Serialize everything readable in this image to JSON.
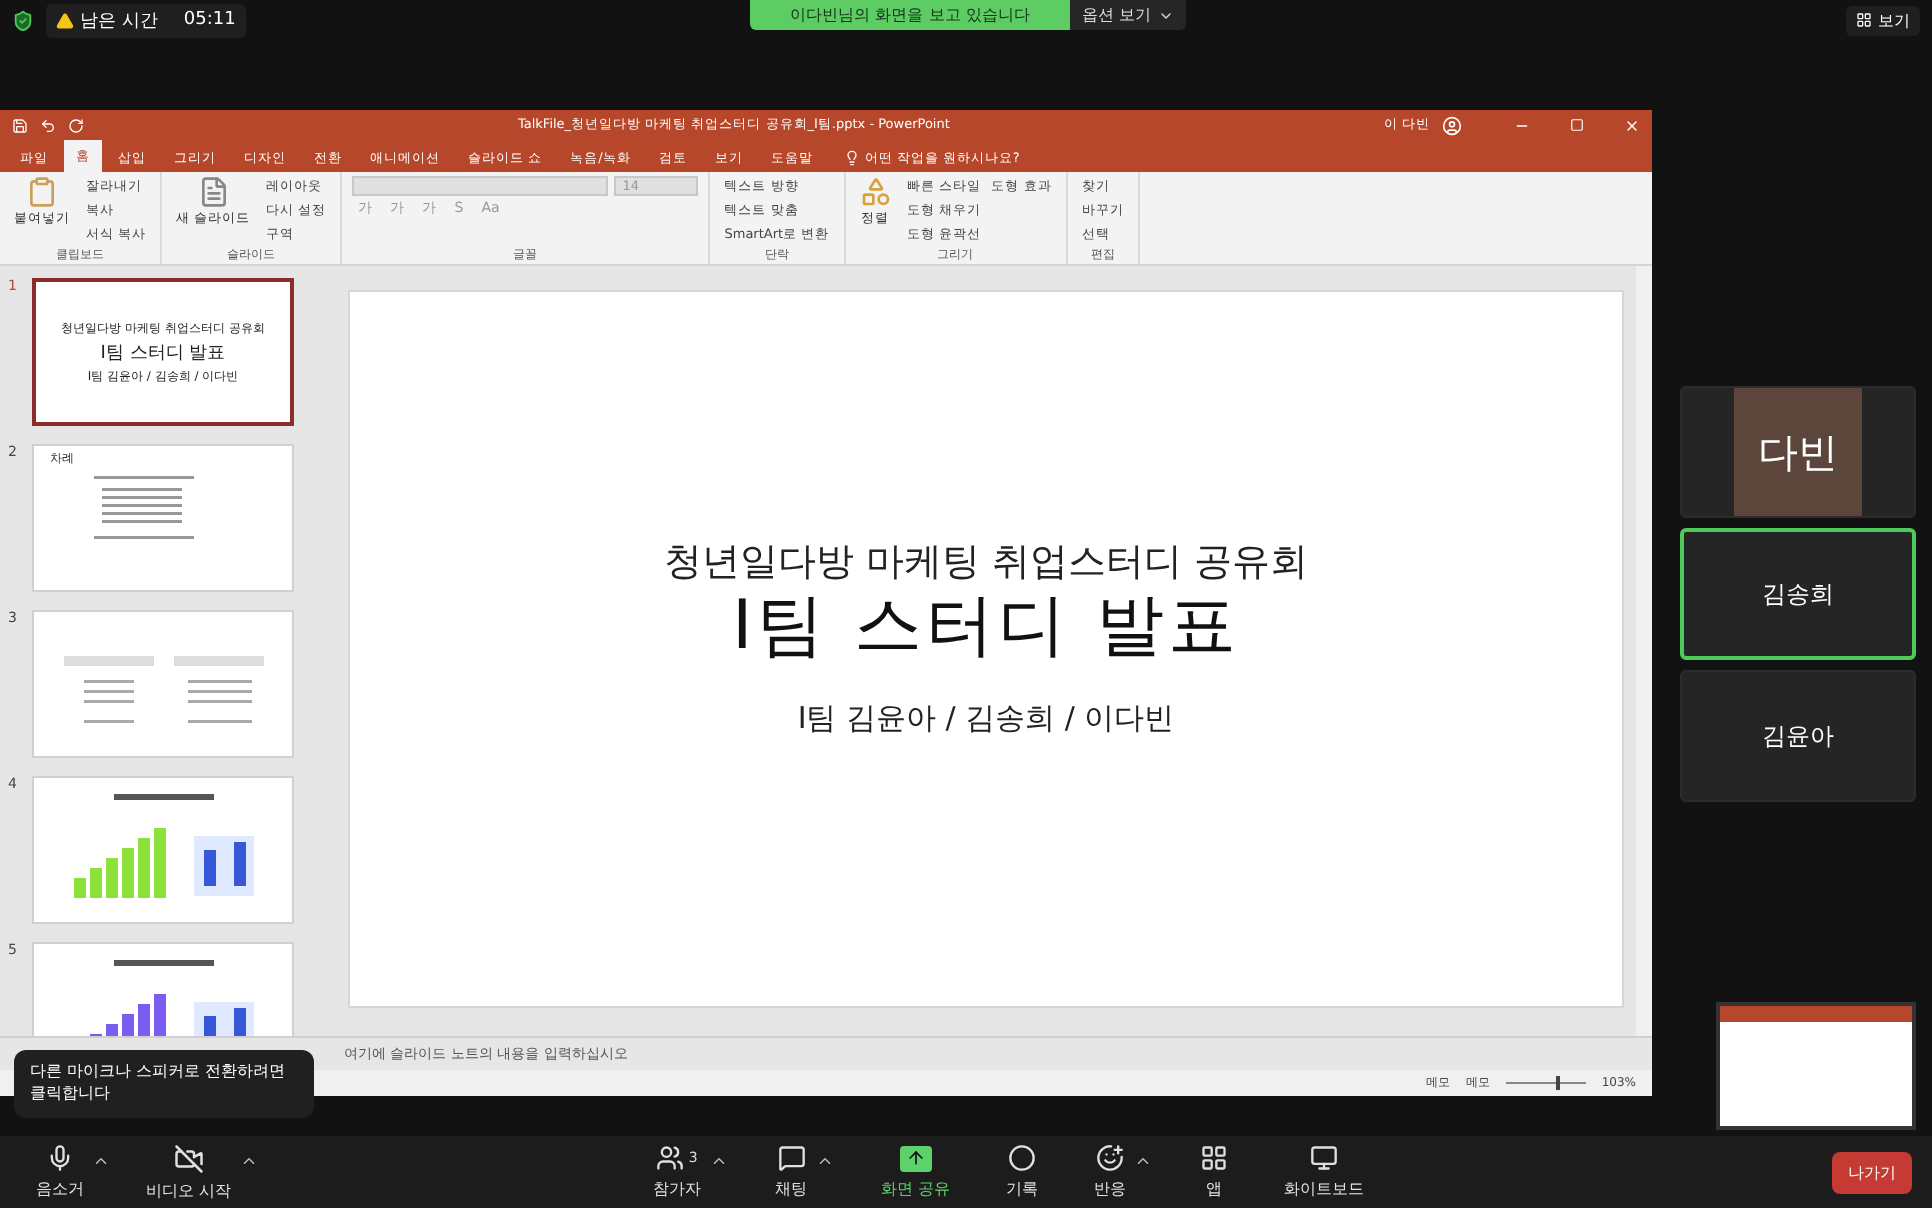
{
  "top_bar": {
    "time_label": "남은 시간",
    "time": "05:11",
    "sharing_banner": "이다빈님의 화면을 보고 있습니다",
    "options_button": "옵션 보기",
    "view_button": "보기"
  },
  "ppt": {
    "title": "TalkFile_청년일다방 마케팅 취업스터디 공유회_I팀.pptx  -  PowerPoint",
    "user": "이 다빈",
    "tabs": [
      {
        "label": "파일",
        "selected": false
      },
      {
        "label": "홈",
        "selected": true
      },
      {
        "label": "삽입",
        "selected": false
      },
      {
        "label": "그리기",
        "selected": false
      },
      {
        "label": "디자인",
        "selected": false
      },
      {
        "label": "전환",
        "selected": false
      },
      {
        "label": "애니메이션",
        "selected": false
      },
      {
        "label": "슬라이드 쇼",
        "selected": false
      },
      {
        "label": "녹음/녹화",
        "selected": false
      },
      {
        "label": "검토",
        "selected": false
      },
      {
        "label": "보기",
        "selected": false
      },
      {
        "label": "도움말",
        "selected": false
      }
    ],
    "tell_me": "어떤 작업을 원하시나요?",
    "ribbon_groups": [
      {
        "kind": "list",
        "label": "클립보드",
        "big": "붙여넣기",
        "items": [
          "잘라내기",
          "복사",
          "서식 복사"
        ]
      },
      {
        "kind": "list",
        "label": "슬라이드",
        "big": "새 슬라이드",
        "items": [
          "레이아웃",
          "다시 설정",
          "구역"
        ]
      },
      {
        "kind": "font",
        "label": "글꼴",
        "size": "14",
        "items": [
          "가",
          "가",
          "가",
          "S",
          "Aa"
        ]
      },
      {
        "kind": "list",
        "label": "단락",
        "items": [
          "텍스트 방향",
          "텍스트 맞춤",
          "SmartArt로 변환"
        ]
      },
      {
        "kind": "list",
        "label": "그리기",
        "big": "정렬",
        "items": [
          "빠른 스타일",
          "도형 채우기",
          "도형 윤곽선",
          "도형 효과"
        ]
      },
      {
        "kind": "list",
        "label": "편집",
        "items": [
          "찾기",
          "바꾸기",
          "선택"
        ]
      }
    ],
    "slides": [
      {
        "number": "1",
        "selected": true,
        "kind": "title",
        "lines": [
          "청년일다방 마케팅 취업스터디 공유회",
          "I팀 스터디 발표",
          "I팀 김윤아 / 김송희 / 이다빈"
        ]
      },
      {
        "number": "2",
        "selected": false,
        "kind": "toc",
        "lines": [
          "차례"
        ]
      },
      {
        "number": "3",
        "selected": false,
        "kind": "content"
      },
      {
        "number": "4",
        "selected": false,
        "kind": "chart"
      },
      {
        "number": "5",
        "selected": false,
        "kind": "chart"
      }
    ],
    "slide": {
      "subtitle": "청년일다방 마케팅 취업스터디 공유회",
      "title": "I팀 스터디 발표",
      "members": "I팀 김윤아 / 김송희 / 이다빈"
    },
    "notes_placeholder": "여기에 슬라이드 노트의 내용을 입력하십시오",
    "status": {
      "notes": "메모",
      "comments": "메모",
      "zoom": "103%",
      "level": 0.65
    }
  },
  "participants": [
    {
      "name": "다빈",
      "kind": "avatar",
      "selected": false
    },
    {
      "name": "김송희",
      "kind": "name",
      "selected": true
    },
    {
      "name": "김윤아",
      "kind": "name",
      "selected": false
    }
  ],
  "tooltip": "다른 마이크나 스피커로 전환하려면 클릭합니다",
  "toolbar_left": [
    {
      "kind": "mic",
      "label": "음소거"
    },
    {
      "kind": "video",
      "label": "비디오 시작"
    }
  ],
  "toolbar_center": [
    {
      "kind": "participants",
      "label": "참가자",
      "count": "3",
      "caret": true
    },
    {
      "kind": "chat",
      "label": "채팅",
      "caret": true
    },
    {
      "kind": "share",
      "label": "화면 공유",
      "caret": false
    },
    {
      "kind": "record",
      "label": "기록",
      "caret": false
    },
    {
      "kind": "reaction",
      "label": "반응",
      "caret": true
    },
    {
      "kind": "apps",
      "label": "앱",
      "caret": false
    },
    {
      "kind": "whiteboard",
      "label": "화이트보드",
      "caret": false
    }
  ],
  "leave_button": "나가기"
}
